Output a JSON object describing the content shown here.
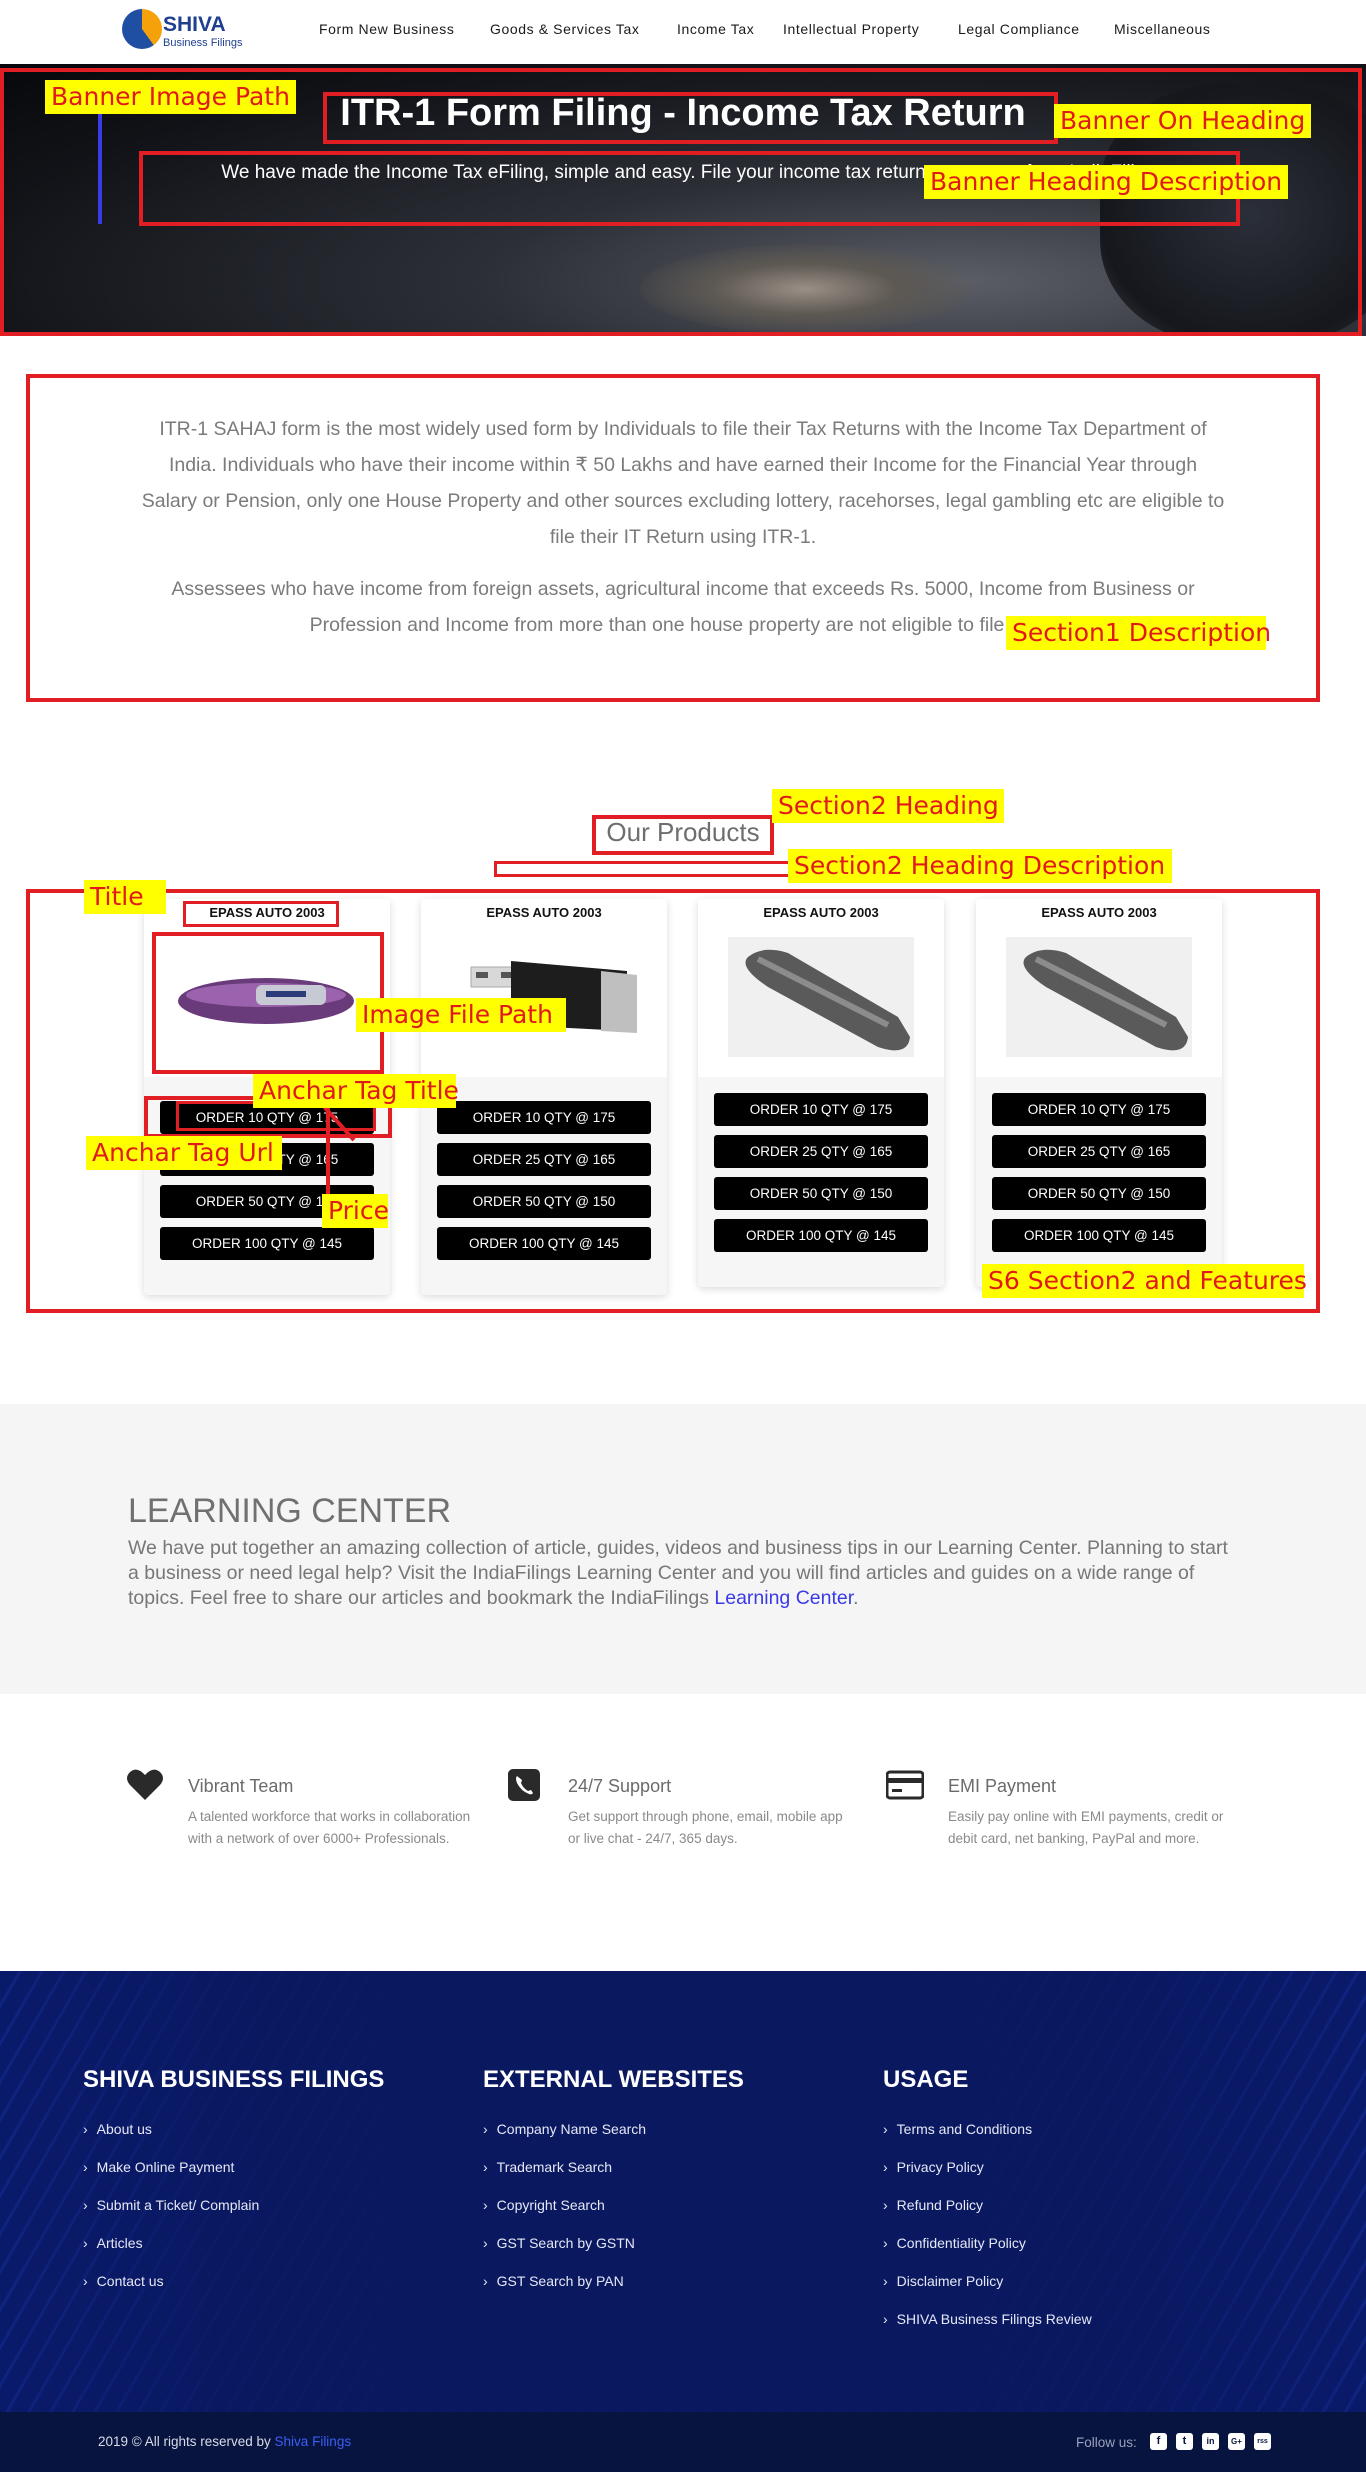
{
  "nav": {
    "logo_text": "SHIVA",
    "logo_sub": "Business Filings",
    "items": [
      "Form New Business",
      "Goods & Services Tax",
      "Income Tax",
      "Intellectual Property",
      "Legal Compliance",
      "Miscellaneous"
    ]
  },
  "banner": {
    "heading": "ITR-1 Form Filing - Income Tax Return",
    "description": "We have made the Income Tax eFiling, simple and easy. File your income tax return on support from IndiaFilings."
  },
  "section1": {
    "paragraph1": "ITR-1 SAHAJ form is the most widely used form by Individuals to file their Tax Returns with the Income Tax Department of India. Individuals who have their income within ₹ 50 Lakhs and have earned their Income for the Financial Year through Salary or Pension, only one House Property and other sources excluding lottery, racehorses, legal gambling etc are eligible to file their IT Return using ITR-1.",
    "paragraph2": "Assessees who have income from foreign assets, agricultural income that exceeds Rs. 5000, Income from Business or Profession and Income from more than one house property are not eligible to file using"
  },
  "products": {
    "heading": "Our Products",
    "cards": [
      {
        "name": "EPASS AUTO 2003",
        "orders": [
          "ORDER 10 QTY @ 175",
          "ORDER 25 QTY @ 165",
          "ORDER 50 QTY @ 150",
          "ORDER 100 QTY @ 145"
        ]
      },
      {
        "name": "EPASS AUTO 2003",
        "orders": [
          "ORDER 10 QTY @ 175",
          "ORDER 25 QTY @ 165",
          "ORDER 50 QTY @ 150",
          "ORDER 100 QTY @ 145"
        ]
      },
      {
        "name": "EPASS AUTO 2003",
        "orders": [
          "ORDER 10 QTY @ 175",
          "ORDER 25 QTY @ 165",
          "ORDER 50 QTY @ 150",
          "ORDER 100 QTY @ 145"
        ]
      },
      {
        "name": "EPASS AUTO 2003",
        "orders": [
          "ORDER 10 QTY @ 175",
          "ORDER 25 QTY @ 165",
          "ORDER 50 QTY @ 150",
          "ORDER 100 QTY @ 145"
        ]
      }
    ]
  },
  "annotations": {
    "banner_image_path": "Banner Image Path",
    "banner_on_heading": "Banner On Heading",
    "banner_heading_description": "Banner Heading Description",
    "section1_description": "Section1 Description",
    "section2_heading": "Section2 Heading",
    "section2_heading_description": "Section2 Heading Description",
    "title": "Title",
    "image_file_path": "Image File Path",
    "anchar_tag_title": "Anchar Tag Title",
    "anchar_tag_url": "Anchar Tag Url",
    "price": "Price",
    "s6_section2": "S6 Section2 and Features"
  },
  "learning": {
    "heading": "LEARNING CENTER",
    "text": "We have put together an amazing collection of article, guides, videos and business tips in our Learning Center. Planning to start a business or need legal help? Visit the IndiaFilings Learning Center and you will find articles and guides on a wide range of topics. Feel free to share our articles and bookmark the IndiaFilings ",
    "link": "Learning Center",
    "after": "."
  },
  "features": [
    {
      "icon": "heart-icon",
      "title": "Vibrant Team",
      "text": "A talented workforce that works in collaboration with a network of over 6000+ Professionals."
    },
    {
      "icon": "phone-icon",
      "title": "24/7 Support",
      "text": "Get support through phone, email, mobile app or live chat - 24/7, 365 days."
    },
    {
      "icon": "credit-card-icon",
      "title": "EMI Payment",
      "text": "Easily pay online with EMI payments, credit or debit card, net banking, PayPal and more."
    }
  ],
  "footer": {
    "col1": {
      "heading": "SHIVA BUSINESS FILINGS",
      "links": [
        "About us",
        "Make Online Payment",
        "Submit a Ticket/ Complain",
        "Articles",
        "Contact us"
      ]
    },
    "col2": {
      "heading": "EXTERNAL WEBSITES",
      "links": [
        "Company Name Search",
        "Trademark Search",
        "Copyright Search",
        "GST Search by GSTN",
        "GST Search by PAN"
      ]
    },
    "col3": {
      "heading": "USAGE",
      "links": [
        "Terms and Conditions",
        "Privacy Policy",
        "Refund Policy",
        "Confidentiality Policy",
        "Disclaimer Policy",
        "SHIVA Business Filings Review"
      ]
    },
    "copyright": "2019 © All rights reserved by ",
    "copyright_link": "Shiva Filings",
    "follow": "Follow us:",
    "social": [
      "f",
      "t",
      "in",
      "G+",
      "rss"
    ]
  }
}
